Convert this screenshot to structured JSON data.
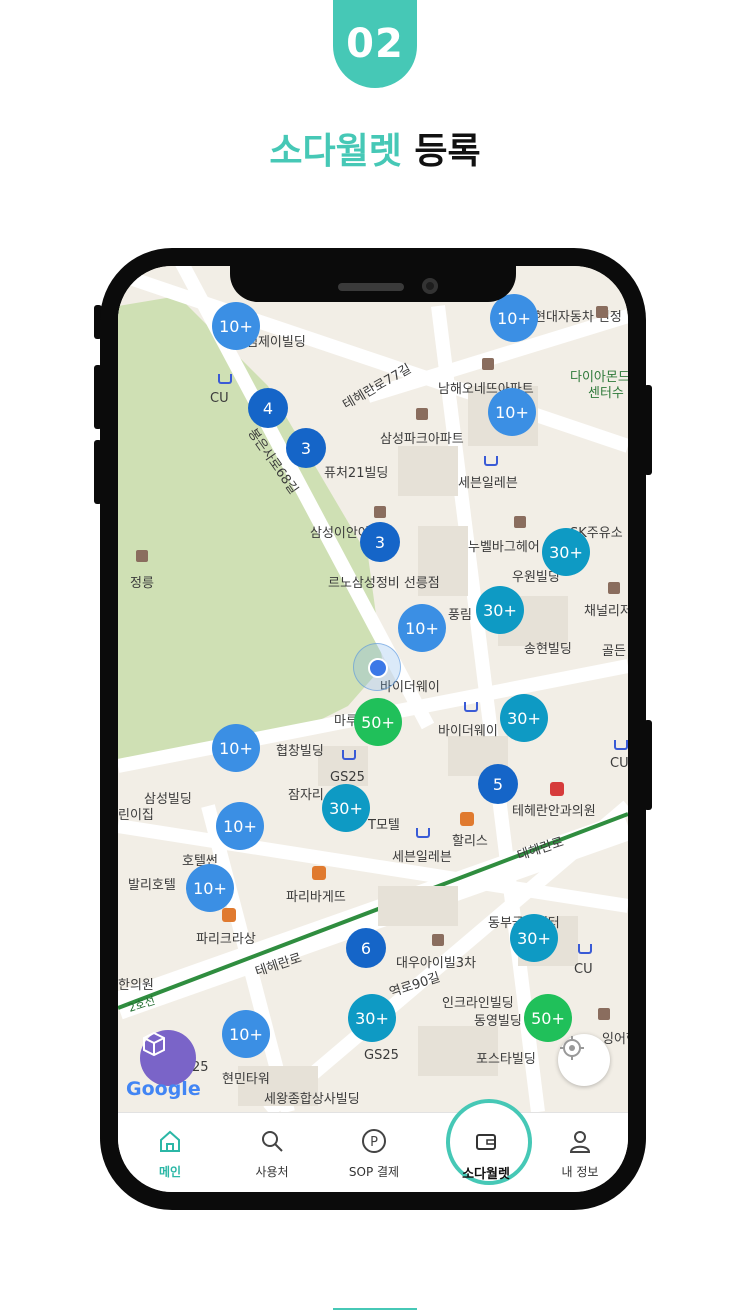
{
  "header": {
    "step": "02",
    "title_accent": "소다월렛",
    "title_rest": "등록"
  },
  "colors": {
    "accent": "#46c8b6",
    "cluster_light": "#3b8fe4",
    "cluster_dark": "#1565c8",
    "cluster_teal": "#0e9ac4",
    "cluster_green": "#20c05a"
  },
  "map": {
    "labels": [
      "엠제이빌딩",
      "CU",
      "테헤란로77길",
      "남해오네뜨아파트",
      "다이아몬드",
      "센터수",
      "현대자동차 선정",
      "봉은사로68길",
      "삼성파크아파트",
      "퓨처21빌딩",
      "세븐일레븐",
      "삼성이안아파트",
      "누벨바그헤어",
      "SK주유소",
      "정릉",
      "르노삼성정비 선릉점",
      "우원빌딩",
      "채널리저",
      "풍림",
      "송현빌딩",
      "골든",
      "바이더웨이",
      "마루",
      "바이더웨이",
      "CU",
      "협창빌딩",
      "GS25",
      "잠자리",
      "T모텔",
      "테헤란안과의원",
      "삼성빌딩",
      "린이집",
      "호텔썬",
      "할리스",
      "세븐일레븐",
      "테헤란로",
      "발리호텔",
      "파리바게뜨",
      "파리크라상",
      "동부금융센터",
      "대우아이빌3차",
      "CU",
      "테헤란로",
      "한의원",
      "2호선",
      "인크라인빌딩",
      "동영빌딩",
      "역로90길",
      "GS25",
      "포스타빌딩",
      "잉어학",
      "현민타워",
      "25",
      "세왕종합상사빌딩",
      "Google"
    ],
    "clusters": [
      "10+",
      "10+",
      "4",
      "3",
      "10+",
      "3",
      "30+",
      "30+",
      "10+",
      "50+",
      "30+",
      "10+",
      "5",
      "30+",
      "10+",
      "10+",
      "6",
      "30+",
      "30+",
      "50+",
      "10+"
    ]
  },
  "tabs": [
    {
      "label": "메인",
      "icon": "home-icon"
    },
    {
      "label": "사용처",
      "icon": "search-icon"
    },
    {
      "label": "SOP 결제",
      "icon": "pay-icon"
    },
    {
      "label": "소다월렛",
      "icon": "wallet-icon"
    },
    {
      "label": "내 정보",
      "icon": "user-icon"
    }
  ]
}
